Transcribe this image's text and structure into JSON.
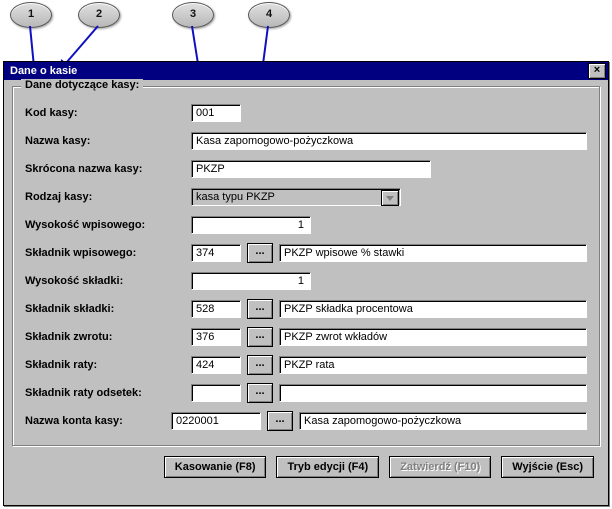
{
  "callouts": {
    "1": "1",
    "2": "2",
    "3": "3",
    "4": "4"
  },
  "window": {
    "title": "Dane o kasie",
    "close_glyph": "×"
  },
  "group": {
    "legend": "Dane dotyczące kasy:"
  },
  "labels": {
    "kod": "Kod kasy:",
    "nazwa": "Nazwa kasy:",
    "skrocona": "Skrócona nazwa kasy:",
    "rodzaj": "Rodzaj kasy:",
    "wpisowe": "Wysokość wpisowego:",
    "skl_wpis": "Składnik wpisowego:",
    "skladka": "Wysokość składki:",
    "skl_skladki": "Składnik składki:",
    "skl_zwrotu": "Składnik zwrotu:",
    "skl_raty": "Składnik raty:",
    "skl_raty_ods": "Składnik raty odsetek:",
    "konto": "Nazwa konta kasy:"
  },
  "values": {
    "kod": "001",
    "nazwa": "Kasa zapomogowo-pożyczkowa",
    "skrocona": "PKZP",
    "rodzaj": "kasa typu PKZP",
    "wpisowe": "1",
    "skl_wpis_code": "374",
    "skl_wpis_desc": "PKZP wpisowe % stawki",
    "skladka": "1",
    "skl_skladki_code": "528",
    "skl_skladki_desc": "PKZP składka procentowa",
    "skl_zwrotu_code": "376",
    "skl_zwrotu_desc": "PKZP zwrot wkładów",
    "skl_raty_code": "424",
    "skl_raty_desc": "PKZP rata",
    "skl_raty_ods_code": "",
    "skl_raty_ods_desc": "",
    "konto_code": "0220001",
    "konto_desc": "Kasa zapomogowo-pożyczkowa"
  },
  "buttons": {
    "ellipsis": "...",
    "kasowanie": "Kasowanie (F8)",
    "tryb": "Tryb edycji (F4)",
    "zatw": "Zatwierdź (F10)",
    "wyjscie": "Wyjście (Esc)"
  }
}
